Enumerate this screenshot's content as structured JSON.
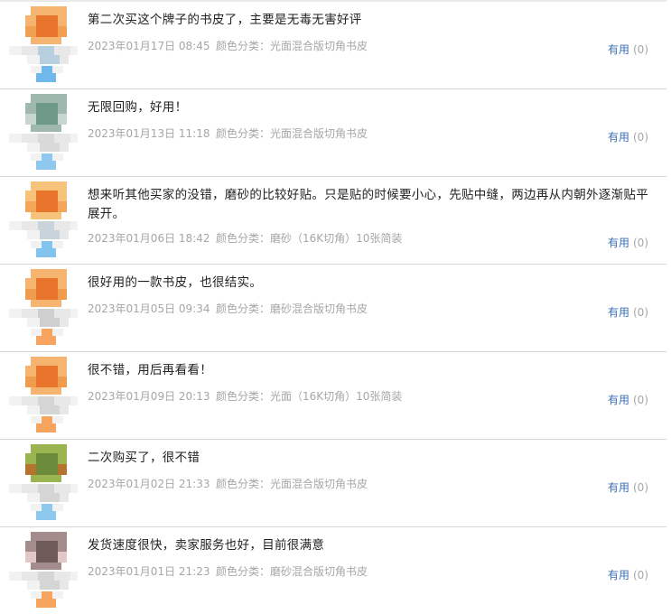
{
  "reviews": [
    {
      "text": "第二次买这个牌子的书皮了，主要是无毒无害好评",
      "date": "2023年01月17日 08:45",
      "variant": "颜色分类：光面混合版切角书皮",
      "useful_label": "有用",
      "useful_count": "(0)",
      "avatar_colors": [
        "#f5b470",
        "#e9742c",
        "#f0a050",
        "#b8cfe0",
        "#6fb8ec"
      ]
    },
    {
      "text": "无限回购，好用！",
      "date": "2023年01月13日 11:18",
      "variant": "颜色分类：光面混合版切角书皮",
      "useful_label": "有用",
      "useful_count": "(0)",
      "avatar_colors": [
        "#9fb8ad",
        "#6f9987",
        "#c8d6d0",
        "#d9d9d9",
        "#8ec8ef"
      ]
    },
    {
      "text": "想来听其他买家的没错，磨砂的比较好贴。只是贴的时候要小心，先贴中缝，两边再从内朝外逐渐贴平展开。",
      "date": "2023年01月06日 18:42",
      "variant": "颜色分类：磨砂（16K切角）10张简装",
      "useful_label": "有用",
      "useful_count": "(0)",
      "avatar_colors": [
        "#f7c27a",
        "#e9742c",
        "#f3a55a",
        "#c9d3dc",
        "#82c4ee"
      ]
    },
    {
      "text": "很好用的一款书皮，也很结实。",
      "date": "2023年01月05日 09:34",
      "variant": "颜色分类：磨砂混合版切角书皮",
      "useful_label": "有用",
      "useful_count": "(0)",
      "avatar_colors": [
        "#f5b470",
        "#e9742c",
        "#f09c4e",
        "#cfcfcf",
        "#f6a45e"
      ]
    },
    {
      "text": "很不错，用后再看看！",
      "date": "2023年01月09日 20:13",
      "variant": "颜色分类：光面（16K切角）10张简装",
      "useful_label": "有用",
      "useful_count": "(0)",
      "avatar_colors": [
        "#f5b470",
        "#e9742c",
        "#f09c4e",
        "#d5d5d5",
        "#f6a45e"
      ]
    },
    {
      "text": "二次购买了，很不错",
      "date": "2023年01月02日 21:33",
      "variant": "颜色分类：光面混合版切角书皮",
      "useful_label": "有用",
      "useful_count": "(0)",
      "avatar_colors": [
        "#9ab54f",
        "#6b8a3a",
        "#b6732e",
        "#d5d5d5",
        "#8ec8ef"
      ]
    },
    {
      "text": "发货速度很快，卖家服务也好，目前很满意",
      "date": "2023年01月01日 21:23",
      "variant": "颜色分类：磨砂混合版切角书皮",
      "useful_label": "有用",
      "useful_count": "(0)",
      "avatar_colors": [
        "#a48c8c",
        "#6f5a5a",
        "#e3c7c7",
        "#d5d5d5",
        "#f6a45e"
      ]
    }
  ]
}
